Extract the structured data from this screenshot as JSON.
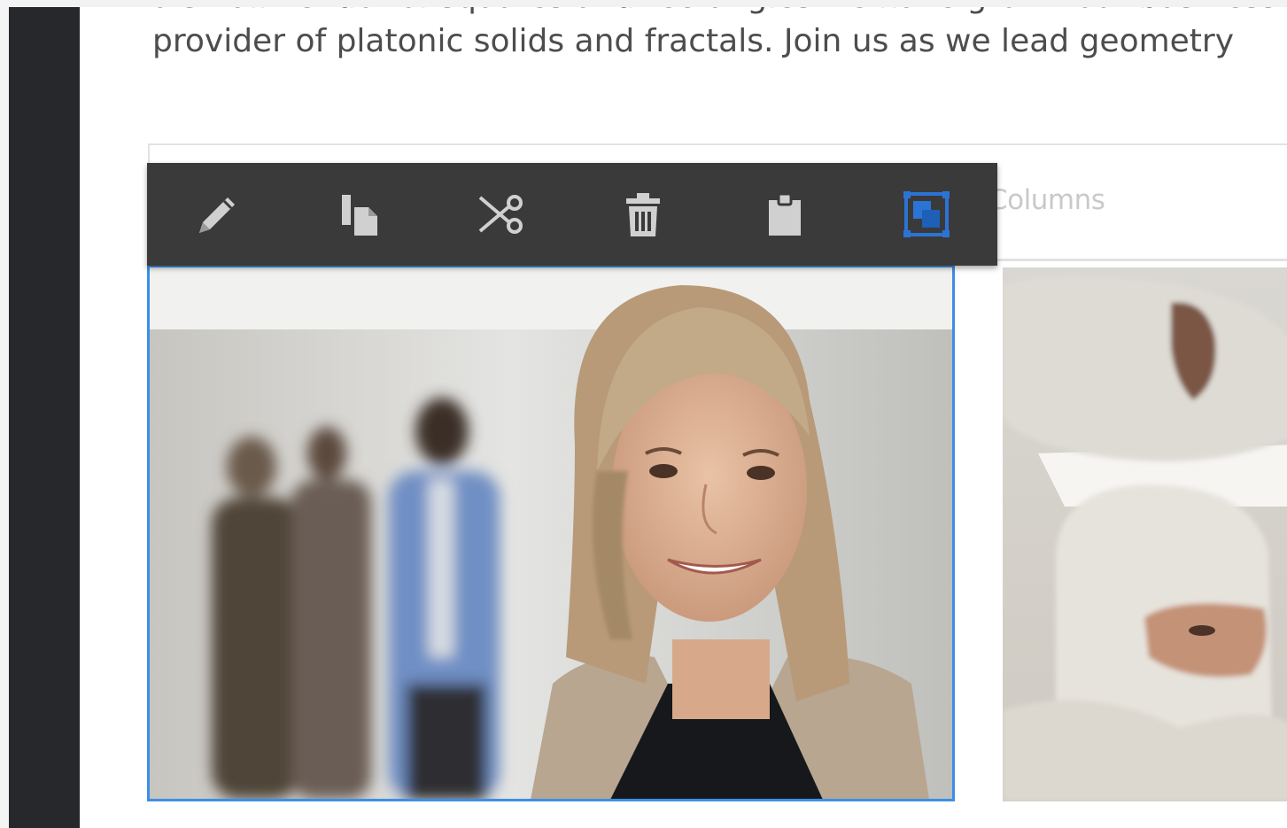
{
  "intro_text": {
    "line1": "a small vendor of squares and rectangles we have grown our business",
    "line2": "provider of platonic solids and fractals. Join us as we lead geometry"
  },
  "columns_component": {
    "label": "Columns"
  },
  "toolbar": {
    "tools": [
      {
        "icon": "pencil-icon",
        "action": "edit"
      },
      {
        "icon": "copy-icon",
        "action": "copy"
      },
      {
        "icon": "scissors-icon",
        "action": "cut"
      },
      {
        "icon": "trash-icon",
        "action": "delete"
      },
      {
        "icon": "clipboard-icon",
        "action": "paste"
      },
      {
        "icon": "group-icon",
        "action": "group",
        "active": true
      }
    ],
    "icon_color": "#d0d0d0",
    "active_color": "#2b74d6",
    "background": "#3a3a3a"
  },
  "selection": {
    "border_color": "#3d8ee5"
  }
}
